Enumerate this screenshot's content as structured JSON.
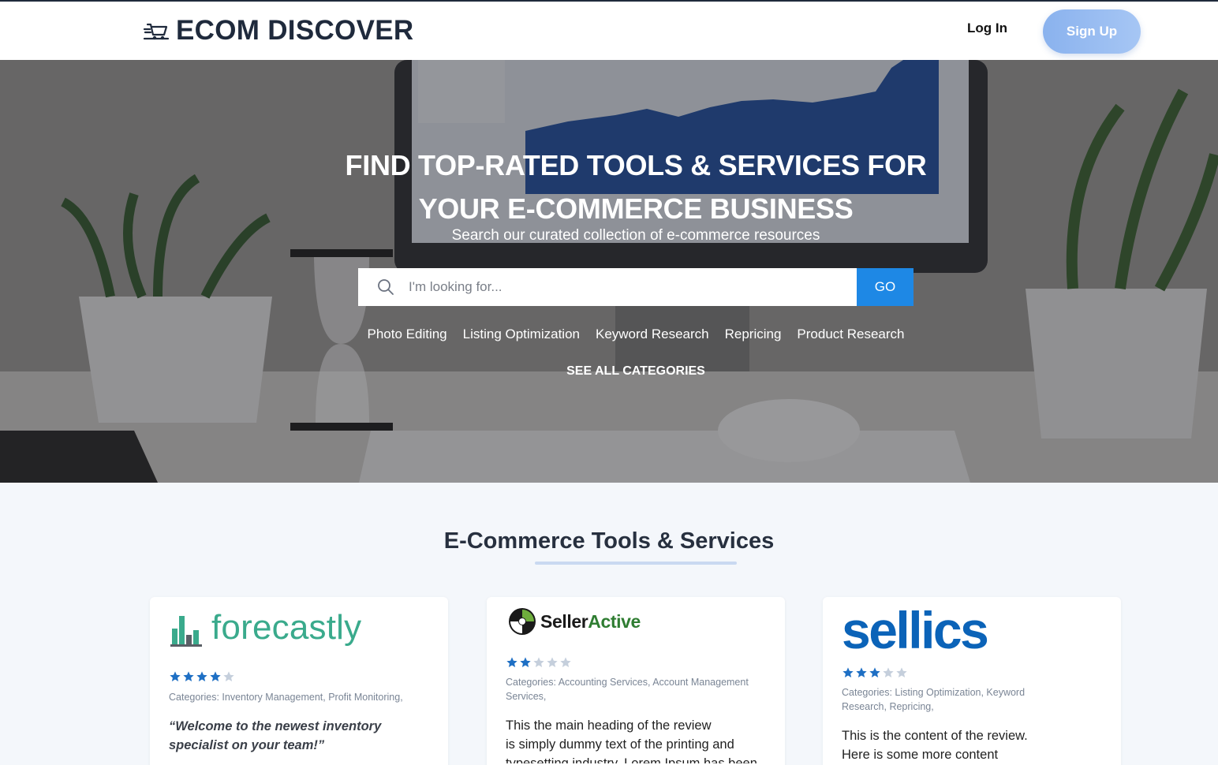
{
  "header": {
    "brand": "ECOM DISCOVER",
    "login_label": "Log In",
    "signup_label": "Sign Up"
  },
  "hero": {
    "title_line1": "FIND TOP-RATED TOOLS & SERVICES FOR",
    "title_line2": "YOUR E-COMMERCE BUSINESS",
    "subtitle": "Search our curated collection of e-commerce resources",
    "search_placeholder": "I'm looking for...",
    "search_value": "",
    "go_label": "GO",
    "categories": [
      "Photo Editing",
      "Listing Optimization",
      "Keyword Research",
      "Repricing",
      "Product Research"
    ],
    "see_all_label": "SEE ALL CATEGORIES"
  },
  "section": {
    "title": "E-Commerce Tools & Services"
  },
  "cards": [
    {
      "brand": "forecastly",
      "rating": 4,
      "categories": "Categories: Inventory Management, Profit Monitoring,",
      "quote_line1": "“Welcome to the newest inventory",
      "quote_line2": "specialist on your team!”"
    },
    {
      "brand_part1": "Seller",
      "brand_part2": "Active",
      "rating": 2,
      "categories_line1": "Categories: Accounting Services, Account Management",
      "categories_line2": "Services,",
      "text_line1": "This the main heading of the review",
      "text_line2": "is simply dummy text of the printing and",
      "text_line3": "typesetting industry. Lorem Ipsum has been"
    },
    {
      "brand": "sellics",
      "rating": 3,
      "categories_line1": "Categories: Listing Optimization, Keyword",
      "categories_line2": "Research, Repricing,",
      "text_line1": "This is the content of the review.",
      "text_line2": "Here is some more content"
    }
  ],
  "colors": {
    "accent": "#1e88e5",
    "signup_gradient_start": "#8ab2ee",
    "star_filled": "#1e6fc4",
    "star_empty": "#c5cfdc",
    "forecastly_green": "#3aaa8c",
    "sellics_blue": "#0b63b8"
  }
}
